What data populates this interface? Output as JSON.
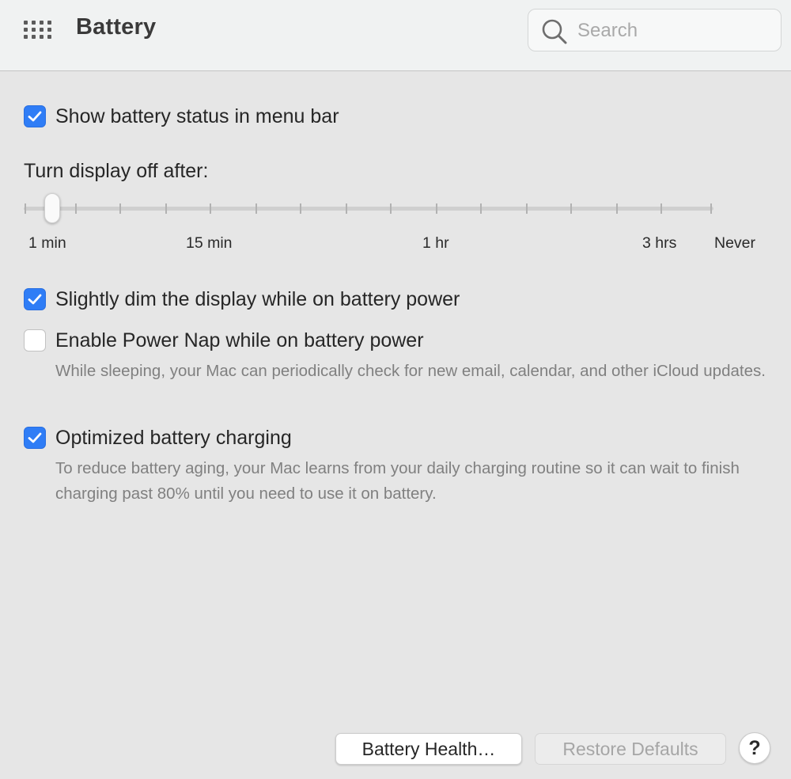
{
  "window": {
    "title": "Battery"
  },
  "toolbar": {
    "grid_icon": "grid-icon",
    "search": {
      "placeholder": "Search",
      "value": "",
      "icon": "magnifying-glass-icon"
    }
  },
  "options": {
    "show_status": {
      "label": "Show battery status in menu bar",
      "checked": true
    },
    "dim_display": {
      "label": "Slightly dim the display while on battery power",
      "checked": true
    },
    "power_nap": {
      "label": "Enable Power Nap while on battery power",
      "checked": false,
      "description": "While sleeping, your Mac can periodically check for new email, calendar, and other iCloud updates."
    },
    "optimized_charging": {
      "label": "Optimized battery charging",
      "checked": true,
      "description": "To reduce battery aging, your Mac learns from your daily charging routine so it can wait to finish charging past 80% until you need to use it on battery."
    }
  },
  "display_off": {
    "label": "Turn display off after:",
    "value": "1 min",
    "tick_labels": [
      "1 min",
      "15 min",
      "1 hr",
      "3 hrs",
      "Never"
    ]
  },
  "buttons": {
    "battery_health": "Battery Health…",
    "restore_defaults": "Restore Defaults",
    "help": "?"
  },
  "colors": {
    "accent": "#2f7df6",
    "background": "#e6e6e6",
    "toolbar": "#f0f2f2",
    "description_text": "#808080"
  }
}
